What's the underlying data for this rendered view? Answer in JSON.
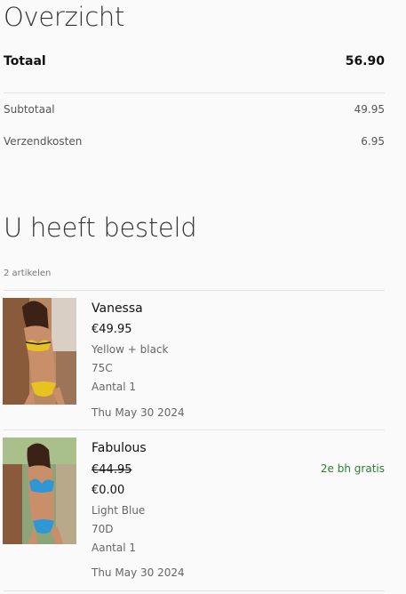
{
  "overview": {
    "title": "Overzicht",
    "total_label": "Totaal",
    "total_value": "56.90",
    "subtotal_label": "Subtotaal",
    "subtotal_value": "49.95",
    "shipping_label": "Verzendkosten",
    "shipping_value": "6.95"
  },
  "ordered": {
    "title": "U heeft besteld",
    "count": "2 artikelen",
    "items": [
      {
        "name": "Vanessa",
        "price": "€49.95",
        "color": "Yellow + black",
        "size": "75C",
        "quantity": "Aantal 1",
        "date": "Thu May 30 2024"
      },
      {
        "name": "Fabulous",
        "old_price": "€44.95",
        "price": "€0.00",
        "promo": "2e bh gratis",
        "color": "Light Blue",
        "size": "70D",
        "quantity": "Aantal 1",
        "date": "Thu May 30 2024"
      }
    ]
  },
  "colors": {
    "background": "#fafafa",
    "promo_green": "#2e7d32",
    "divider": "#e2e2e2"
  }
}
